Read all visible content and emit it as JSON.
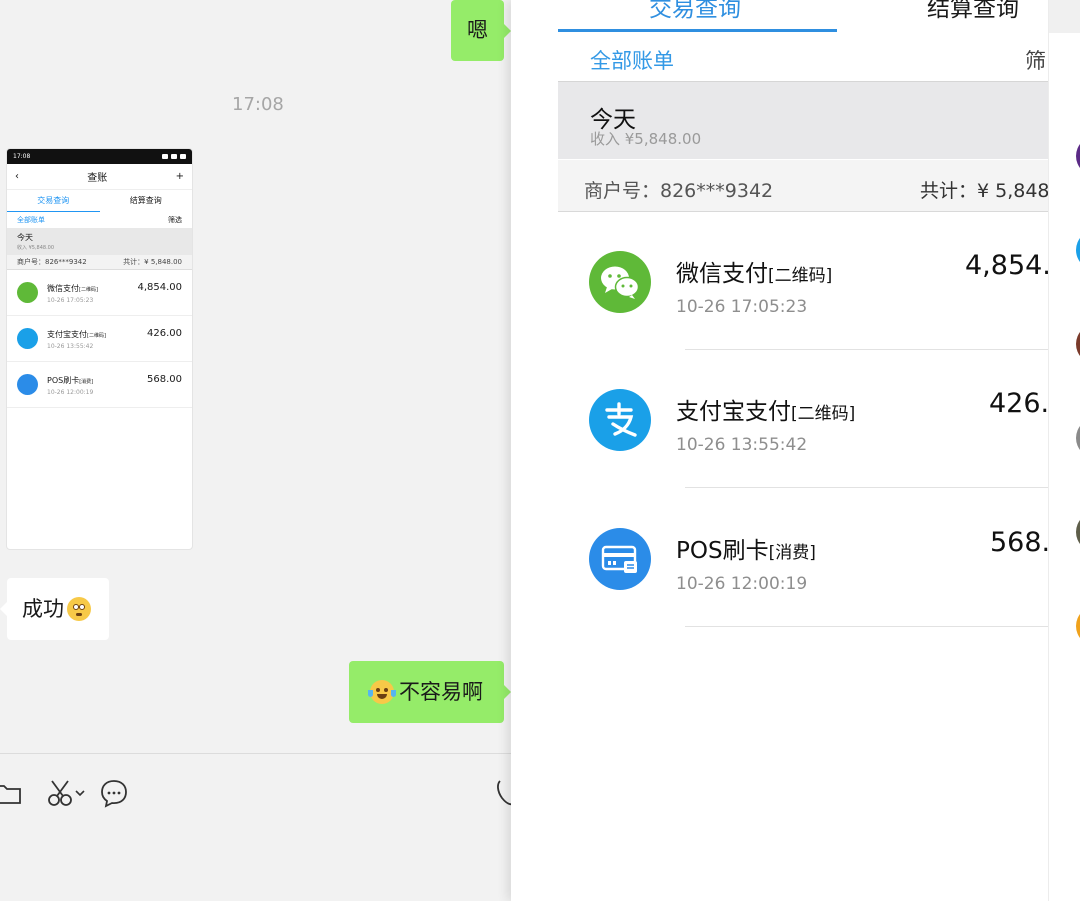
{
  "chat": {
    "msg_en": "嗯",
    "timestamp": "17:08",
    "msg_success": "成功",
    "msg_hard": "不容易啊",
    "tools": [
      "folder-icon",
      "scissors-icon",
      "comment-icon",
      "phone-icon"
    ]
  },
  "thumbnail": {
    "status_time": "17:08",
    "title": "查账",
    "tabs": [
      "交易查询",
      "结算查询"
    ],
    "all_bills": "全部账单",
    "filter": "筛选",
    "today": "今天",
    "today_income": "收入 ¥5,848.00",
    "merchant": "商户号：826***9342",
    "total": "共计：¥ 5,848.00",
    "rows": [
      {
        "name": "微信支付",
        "tag": "[二维码]",
        "time": "10-26 17:05:23",
        "amount": "4,854.00"
      },
      {
        "name": "支付宝支付",
        "tag": "[二维码]",
        "time": "10-26 13:55:42",
        "amount": "426.00"
      },
      {
        "name": "POS刷卡",
        "tag": "[消费]",
        "time": "10-26 12:00:19",
        "amount": "568.00"
      }
    ]
  },
  "panel": {
    "tabs": [
      "交易查询",
      "结算查询"
    ],
    "all_bills": "全部账单",
    "filter": "筛",
    "today": "今天",
    "today_income": "收入 ¥5,848.00",
    "merchant": "商户号：826***9342",
    "total": "共计：¥ 5,848",
    "transactions": [
      {
        "name": "微信支付",
        "tag": "[二维码]",
        "time": "10-26 17:05:23",
        "amount": "4,854.",
        "icon": "wechat-pay-icon",
        "color": "#5fb938"
      },
      {
        "name": "支付宝支付",
        "tag": "[二维码]",
        "time": "10-26 13:55:42",
        "amount": "426.",
        "icon": "alipay-icon",
        "color": "#1aa0e8"
      },
      {
        "name": "POS刷卡",
        "tag": "[消费]",
        "time": "10-26 12:00:19",
        "amount": "568.",
        "icon": "pos-card-icon",
        "color": "#2b8ce8"
      }
    ]
  },
  "colors": {
    "accent": "#2f8fe0",
    "chat_green": "#95ec69",
    "wechat": "#5fb938",
    "alipay": "#1aa0e8"
  }
}
